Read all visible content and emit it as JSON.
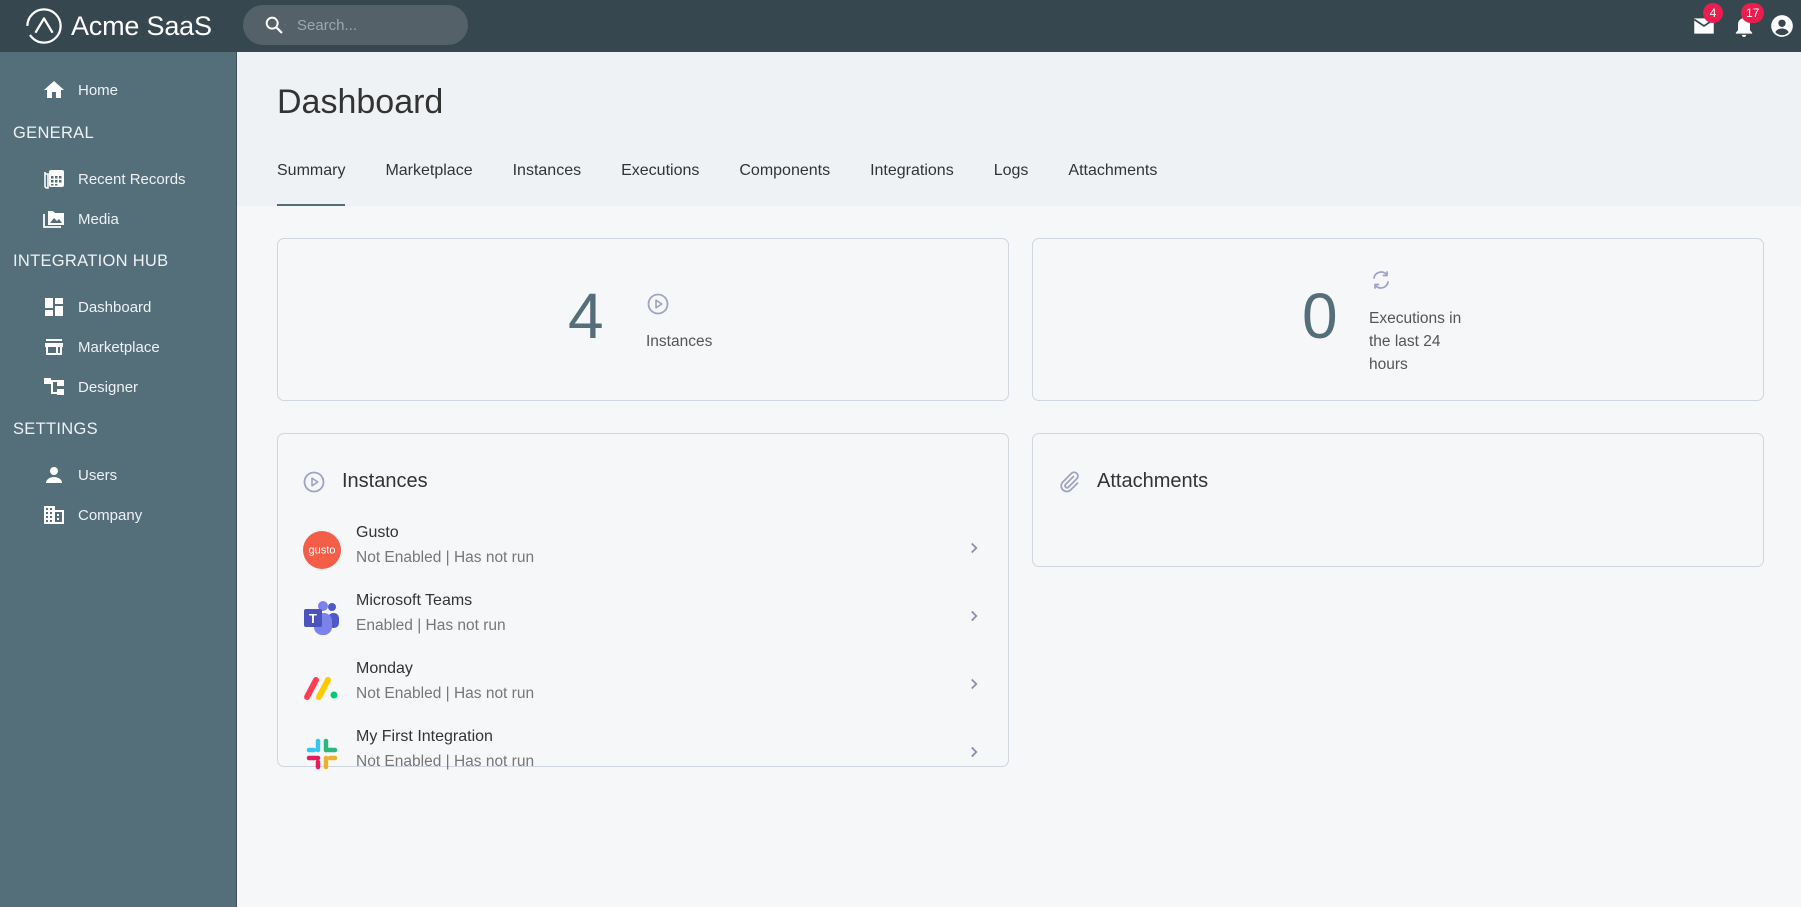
{
  "app": {
    "name": "Acme SaaS"
  },
  "search": {
    "placeholder": "Search..."
  },
  "topbar": {
    "mail_badge": "4",
    "notifications_badge": "17"
  },
  "sidebar": {
    "home": "Home",
    "sections": [
      {
        "label": "GENERAL",
        "items": [
          "Recent Records",
          "Media"
        ]
      },
      {
        "label": "INTEGRATION HUB",
        "items": [
          "Dashboard",
          "Marketplace",
          "Designer"
        ]
      },
      {
        "label": "SETTINGS",
        "items": [
          "Users",
          "Company"
        ]
      }
    ]
  },
  "page": {
    "title": "Dashboard",
    "tabs": [
      "Summary",
      "Marketplace",
      "Instances",
      "Executions",
      "Components",
      "Integrations",
      "Logs",
      "Attachments"
    ],
    "active_tab": "Summary"
  },
  "stats": {
    "instances": {
      "value": "4",
      "label": "Instances"
    },
    "executions": {
      "value": "0",
      "label": "Executions in the last 24 hours"
    }
  },
  "instances_card": {
    "title": "Instances",
    "items": [
      {
        "name": "Gusto",
        "status": "Not Enabled | Has not run",
        "logo": "gusto-logo",
        "color": "#f45d48"
      },
      {
        "name": "Microsoft Teams",
        "status": "Enabled | Has not run",
        "logo": "microsoft-teams-logo",
        "color": "#5059c9"
      },
      {
        "name": "Monday",
        "status": "Not Enabled | Has not run",
        "logo": "monday-logo",
        "color": "#ff3d57"
      },
      {
        "name": "My First Integration",
        "status": "Not Enabled | Has not run",
        "logo": "slack-logo",
        "color": "#36c5f0"
      }
    ]
  },
  "attachments_card": {
    "title": "Attachments"
  },
  "colors": {
    "topbar": "#37474f",
    "sidebar": "#546e7a",
    "accent": "#546e7a",
    "badge": "#e91e4f",
    "icon_muted": "#9fa3c4"
  }
}
